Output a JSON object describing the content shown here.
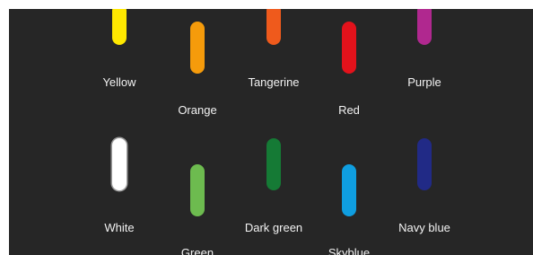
{
  "swatches": [
    {
      "label": "Yellow",
      "color": "#ffe800"
    },
    {
      "label": "Orange",
      "color": "#f59b0b"
    },
    {
      "label": "Tangerine",
      "color": "#ef5a1c"
    },
    {
      "label": "Red",
      "color": "#e3121b"
    },
    {
      "label": "Purple",
      "color": "#b0288f"
    },
    {
      "label": "White",
      "color": "#ffffff"
    },
    {
      "label": "Green",
      "color": "#6dbb4f"
    },
    {
      "label": "Dark green",
      "color": "#157a35"
    },
    {
      "label": "Skyblue",
      "color": "#0f9ee0"
    },
    {
      "label": "Navy blue",
      "color": "#212a86"
    }
  ]
}
